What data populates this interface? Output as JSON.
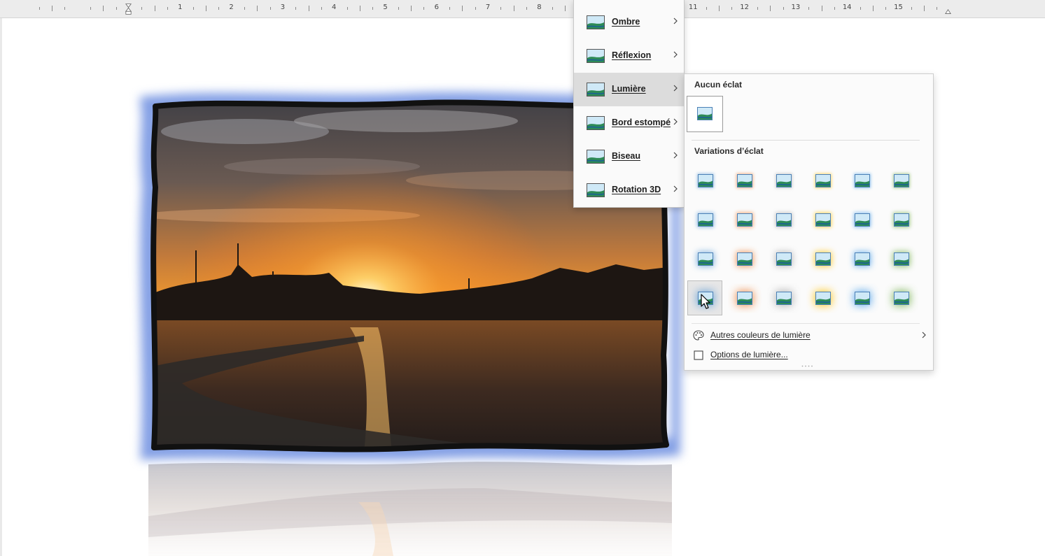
{
  "ruler": {
    "numbers_left": [
      "1",
      "2",
      "3",
      "4",
      "5",
      "6",
      "7",
      "8"
    ],
    "numbers_right": [
      "11",
      "12",
      "13",
      "14",
      "15"
    ]
  },
  "effects_menu": {
    "items": [
      {
        "label": "Ombre",
        "icon": "shadow-effect-icon"
      },
      {
        "label": "Réflexion",
        "icon": "reflection-effect-icon"
      },
      {
        "label": "Lumière",
        "icon": "glow-effect-icon",
        "active": true
      },
      {
        "label": "Bord estompé",
        "icon": "soft-edge-effect-icon"
      },
      {
        "label": "Biseau",
        "icon": "bevel-effect-icon"
      },
      {
        "label": "Rotation 3D",
        "icon": "3d-rotation-effect-icon"
      }
    ]
  },
  "glow_submenu": {
    "no_glow_title": "Aucun éclat",
    "variations_title": "Variations d’éclat",
    "colors": [
      "#5b9bd5",
      "#ed7d31",
      "#a5a5a5",
      "#ffc000",
      "#4a9fe8",
      "#70ad47"
    ],
    "rows": 4,
    "hovered_cell": {
      "row": 4,
      "col": 1
    },
    "more_colors_label": "Autres couleurs de lumière",
    "options_label": "Options de lumière..."
  },
  "colors": {
    "glow_blue": "#6f8fe0",
    "frame": "#111111",
    "menu_active": "#dcdcdc"
  }
}
